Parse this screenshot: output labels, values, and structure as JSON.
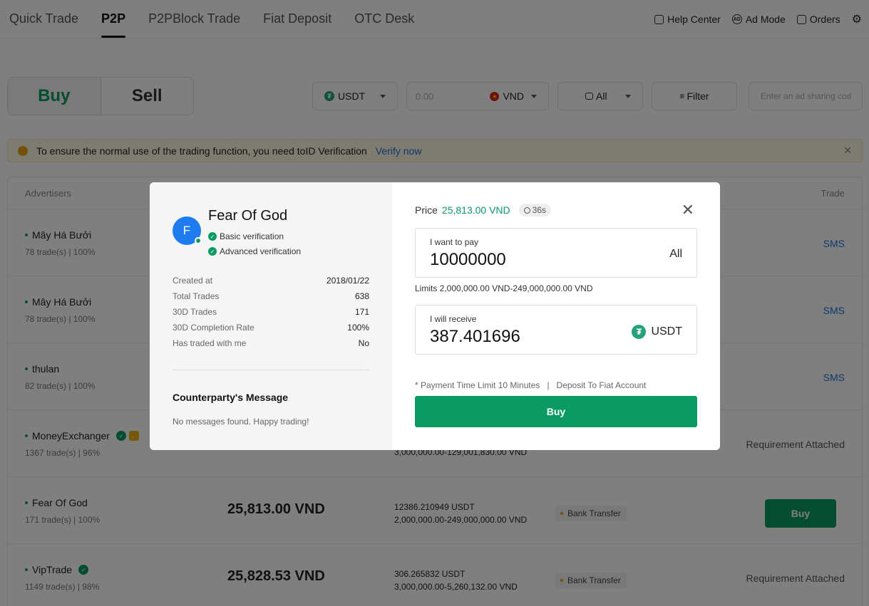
{
  "nav": {
    "tabs": [
      "Quick Trade",
      "P2P",
      "P2PBlock Trade",
      "Fiat Deposit",
      "OTC Desk"
    ],
    "help_center": "Help Center",
    "ad_mode": "Ad Mode",
    "orders": "Orders"
  },
  "filters": {
    "buy": "Buy",
    "sell": "Sell",
    "coin": "USDT",
    "amount_placeholder": "0.00",
    "fiat": "VND",
    "payment": "All",
    "filter": "Filter",
    "ad_code_placeholder": "Enter an ad sharing cod"
  },
  "notice": {
    "text": "To ensure the normal use of the trading function, you need toID Verification",
    "link": "Verify now"
  },
  "table": {
    "col_advertisers": "Advertisers",
    "col_trade": "Trade",
    "rows": [
      {
        "name": "Mây Há Bưởi",
        "stats": "78 trade(s) | 100%",
        "trade": "SMS"
      },
      {
        "name": "Mây Há Bưởi",
        "stats": "78 trade(s) | 100%",
        "trade": "SMS"
      },
      {
        "name": "thulan",
        "stats": "82 trade(s) | 100%",
        "trade": "SMS"
      },
      {
        "name": "MoneyExchanger",
        "stats": "1367 trade(s) | 96%",
        "avail2": "3,000,000.00-129,001,830.00 VND",
        "trade": "Requirement Attached"
      },
      {
        "name": "Fear Of God",
        "stats": "171 trade(s) | 100%",
        "price": "25,813.00 VND",
        "avail1": "12386.210949 USDT",
        "avail2": "2,000,000.00-249,000,000.00 VND",
        "pay": "Bank Transfer",
        "trade": "Buy"
      },
      {
        "name": "VipTrade",
        "stats": "1149 trade(s) | 98%",
        "price": "25,828.53 VND",
        "avail1": "306.265832 USDT",
        "avail2": "3,000,000.00-5,260,132.00 VND",
        "pay": "Bank Transfer",
        "trade": "Requirement Attached"
      }
    ]
  },
  "modal": {
    "avatar_letter": "F",
    "name": "Fear Of God",
    "basic_verification": "Basic verification",
    "advanced_verification": "Advanced verification",
    "info": [
      {
        "k": "Created at",
        "v": "2018/01/22"
      },
      {
        "k": "Total Trades",
        "v": "638"
      },
      {
        "k": "30D Trades",
        "v": "171"
      },
      {
        "k": "30D Completion Rate",
        "v": "100%"
      },
      {
        "k": "Has traded with me",
        "v": "No"
      }
    ],
    "message_title": "Counterparty's Message",
    "message_text": "No messages found. Happy trading!",
    "price_label": "Price",
    "price_value": "25,813.00 VND",
    "timer": "36s",
    "pay_label": "I want to pay",
    "pay_value": "10000000",
    "pay_all": "All",
    "limits": "Limits 2,000,000.00 VND-249,000,000.00 VND",
    "receive_label": "I will receive",
    "receive_value": "387.401696",
    "receive_coin": "USDT",
    "payment_info": "* Payment Time Limit 10 Minutes   |   Deposit To Fiat Account",
    "buy_button": "Buy"
  },
  "colors": {
    "accent": "#0a9a63",
    "link": "#1e70d8"
  }
}
